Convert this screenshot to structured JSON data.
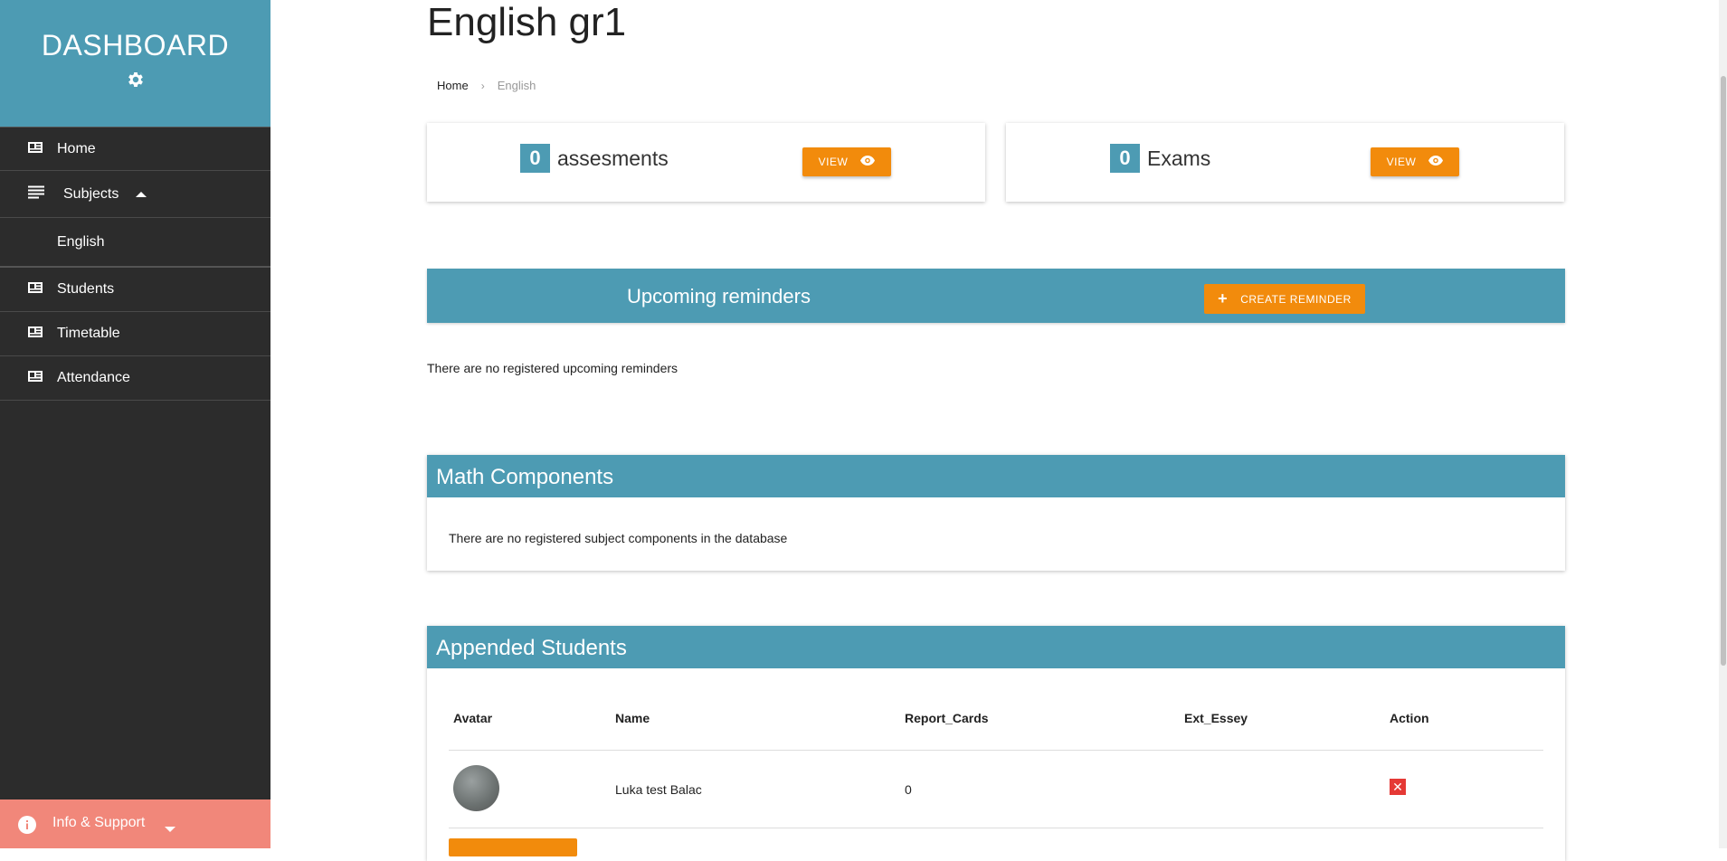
{
  "sidebar": {
    "title": "DASHBOARD",
    "settings_icon": "gear-icon",
    "items": [
      {
        "label": "Home",
        "icon": "id-card-icon"
      },
      {
        "label": "Subjects",
        "icon": "list-icon"
      },
      {
        "label": "English"
      },
      {
        "label": "Students",
        "icon": "id-card-icon"
      },
      {
        "label": "Timetable",
        "icon": "id-card-icon"
      },
      {
        "label": "Attendance",
        "icon": "id-card-icon"
      }
    ],
    "info_label": "Info & Support"
  },
  "page": {
    "title": "English gr1",
    "breadcrumb": [
      "Home",
      "English"
    ]
  },
  "stats": [
    {
      "count": "0",
      "label": "assesments",
      "button": "VIEW"
    },
    {
      "count": "0",
      "label": "Exams",
      "button": "VIEW"
    }
  ],
  "reminders": {
    "title": "Upcoming reminders",
    "create_label": "CREATE REMINDER",
    "empty_text": "There are no registered upcoming reminders"
  },
  "components": {
    "title": "Math Components",
    "empty_text": "There are no registered subject components in the database"
  },
  "students": {
    "title": "Appended Students",
    "columns": [
      "Avatar",
      "Name",
      "Report_Cards",
      "Ext_Essey",
      "Action"
    ],
    "rows": [
      {
        "name": "Luka test Balac",
        "report_cards": "0",
        "ext_essey": ""
      }
    ]
  },
  "colors": {
    "accent": "#4d9bb3",
    "button": "#f28b0c",
    "sidebar": "#2c2c2c",
    "info": "#f1877a",
    "delete": "#e53935"
  }
}
